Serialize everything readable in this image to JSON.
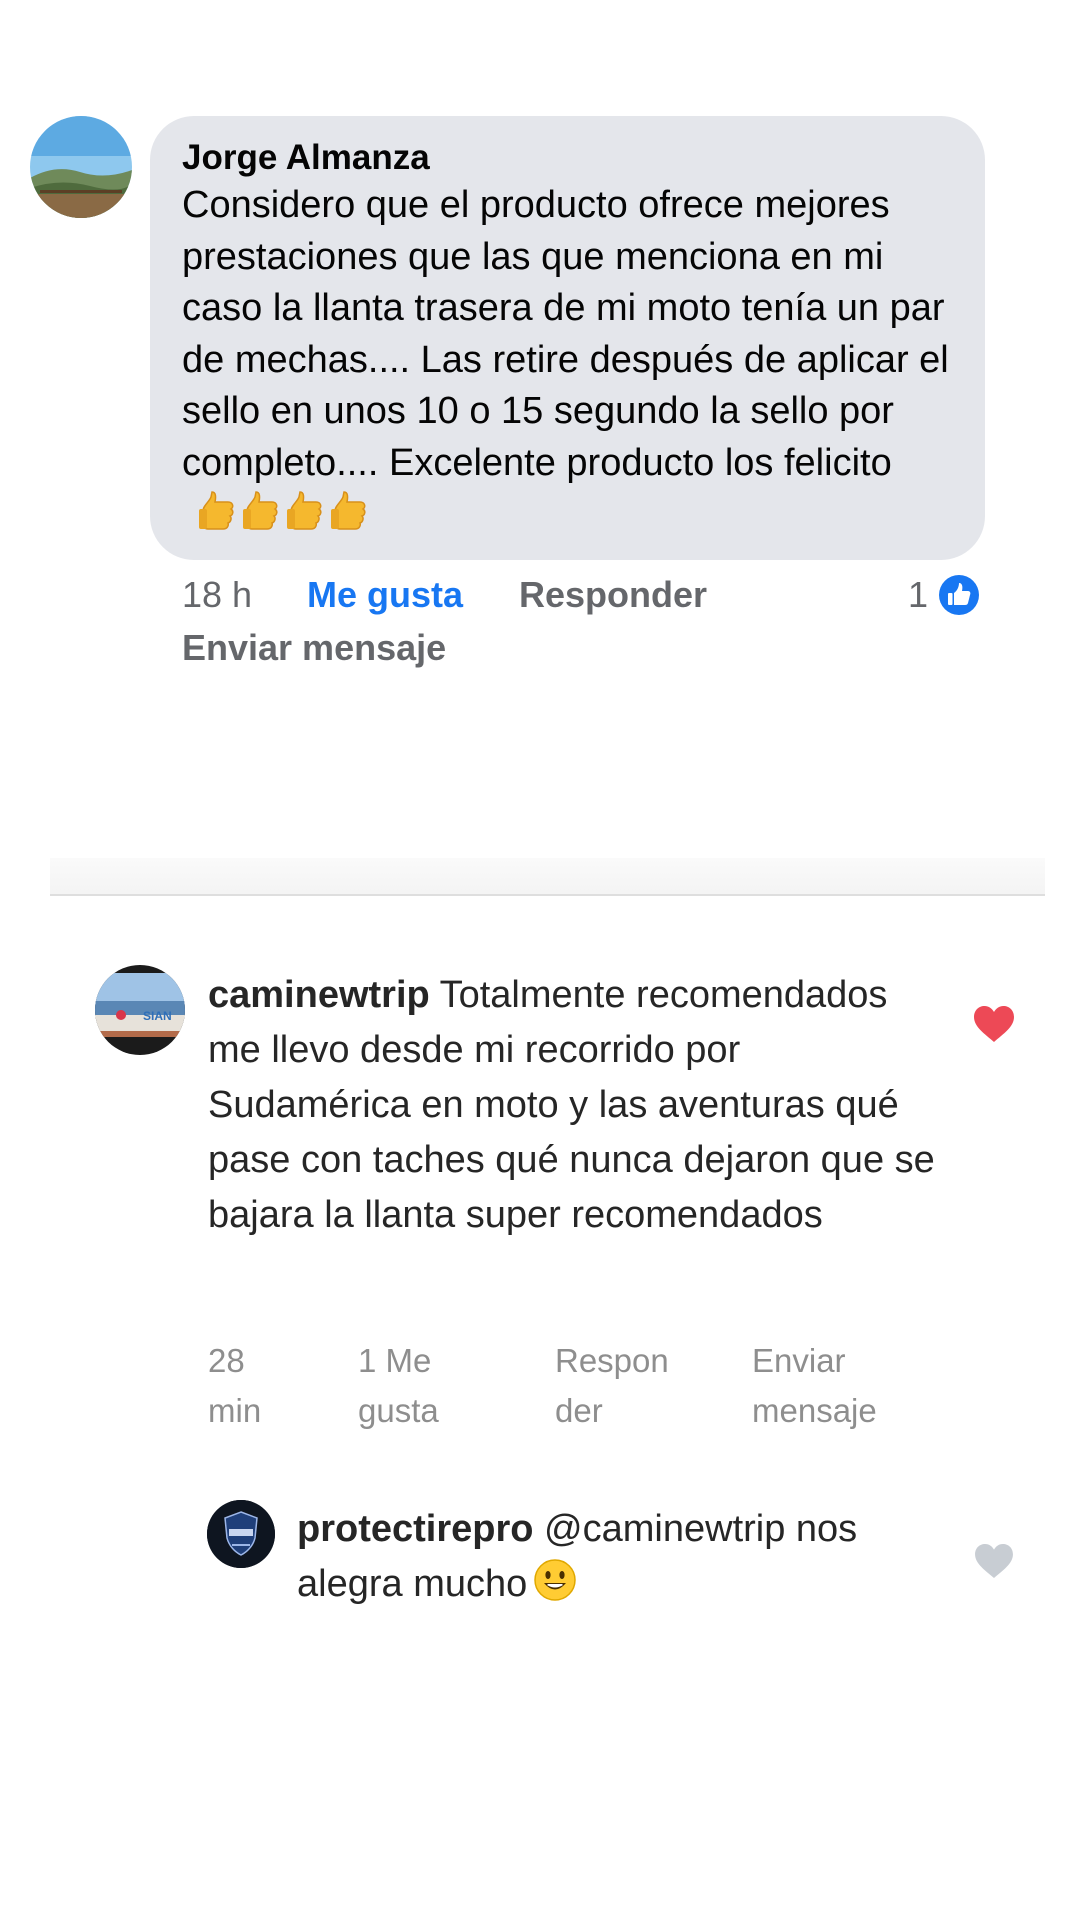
{
  "facebook_comment": {
    "author": "Jorge Almanza",
    "text": "Considero que el producto ofrece mejores prestaciones que las que menciona en mi caso la llanta trasera de mi moto tenía un par de mechas.... Las retire después de aplicar el sello en unos 10 o 15 segundo la sello por completo.... Excelente producto los felicito",
    "emoji": "thumbs-up-icon x4",
    "time": "18 h",
    "like_label": "Me gusta",
    "reply_label": "Responder",
    "like_count": "1",
    "send_message_label": "Enviar mensaje",
    "colors": {
      "bubble": "#e4e6eb",
      "like_accent": "#1877f2",
      "secondary_text": "#65676b"
    }
  },
  "instagram_comment": {
    "username": "caminewtrip",
    "text": "Totalmente recomendados me llevo desde mi recorrido por Sudamérica en moto y las aventuras qué pase con taches qué nunca dejaron que se bajara la llanta super recomendados",
    "liked": true,
    "actions": {
      "time_line1": "28",
      "time_line2": "min",
      "likes_line1": "1 Me",
      "likes_line2": "gusta",
      "reply_line1": "Respon",
      "reply_line2": "der",
      "send_line1": "Enviar",
      "send_line2": "mensaje"
    },
    "colors": {
      "heart_liked": "#ed4956",
      "secondary_text": "#8e8e8e"
    }
  },
  "instagram_reply": {
    "username": "protectirepro",
    "text": "@caminewtrip nos alegra mucho",
    "emoji": "smiling-face-icon",
    "liked": false,
    "colors": {
      "heart_unliked": "#c8cdd3"
    }
  }
}
